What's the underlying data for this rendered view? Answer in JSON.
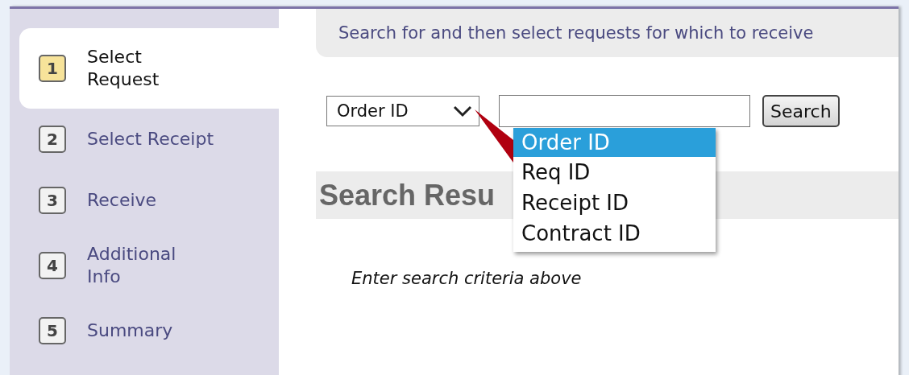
{
  "steps": [
    {
      "number": "1",
      "label": "Select Request",
      "selected": true
    },
    {
      "number": "2",
      "label": "Select Receipt",
      "selected": false
    },
    {
      "number": "3",
      "label": "Receive",
      "selected": false
    },
    {
      "number": "4",
      "label": "Additional Info",
      "selected": false
    },
    {
      "number": "5",
      "label": "Summary",
      "selected": false
    }
  ],
  "instructions": "Search for and then select requests for which to receive",
  "search": {
    "field": {
      "value": "Order ID",
      "open": true,
      "options": [
        {
          "label": "Order ID",
          "selected": true
        },
        {
          "label": "Req ID",
          "selected": false
        },
        {
          "label": "Receipt ID",
          "selected": false
        },
        {
          "label": "Contract ID",
          "selected": false
        }
      ]
    },
    "button": "Search"
  },
  "results": {
    "heading": "Search Resu",
    "message": "Enter search criteria above"
  }
}
